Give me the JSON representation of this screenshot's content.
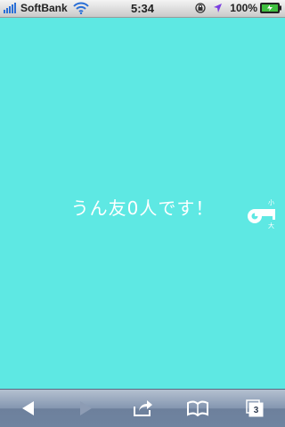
{
  "status_bar": {
    "carrier": "SoftBank",
    "time": "5:34",
    "battery_percent": "100%"
  },
  "main": {
    "message": "うん友0人です！",
    "whistle_labels": {
      "small": "小",
      "large": "大"
    }
  },
  "toolbar": {
    "tab_count": "3"
  },
  "colors": {
    "background": "#5ee8e3",
    "text": "#ffffff"
  }
}
